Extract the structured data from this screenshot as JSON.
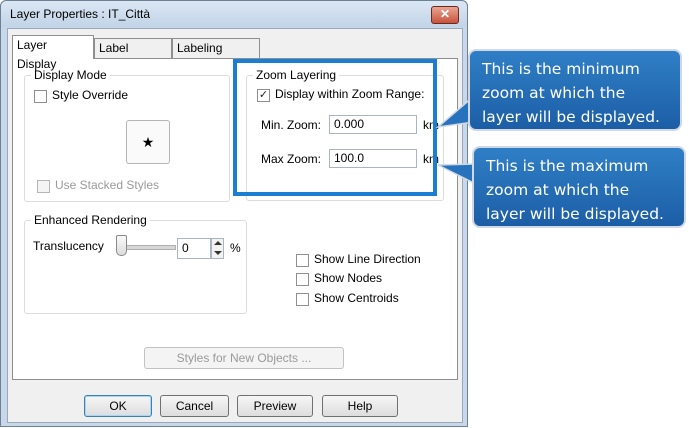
{
  "window": {
    "title": "Layer Properties  : IT_Città",
    "close_glyph": "✕"
  },
  "tabs": [
    {
      "label": "Layer Display",
      "active": true
    },
    {
      "label": "Label Display",
      "active": false
    },
    {
      "label": "Labeling Rules",
      "active": false
    }
  ],
  "display_mode": {
    "title": "Display Mode",
    "style_override": {
      "label": "Style Override",
      "checked": false
    },
    "style_preview_glyph": "★",
    "use_stacked_styles": {
      "label": "Use Stacked Styles",
      "checked": false,
      "enabled": false
    }
  },
  "zoom_layering": {
    "title": "Zoom Layering",
    "display_within_range": {
      "label": "Display within Zoom Range:",
      "checked": true,
      "check_glyph": "✓"
    },
    "min_zoom": {
      "label": "Min. Zoom:",
      "value": "0.000",
      "unit": "km"
    },
    "max_zoom": {
      "label": "Max Zoom:",
      "value": "100.0",
      "unit": "km"
    }
  },
  "enhanced_rendering": {
    "title": "Enhanced Rendering",
    "translucency_label": "Translucency",
    "translucency_value": "0",
    "percent": "%",
    "slider_level_percent": 0
  },
  "options": [
    {
      "label": "Show Line Direction",
      "checked": false
    },
    {
      "label": "Show Nodes",
      "checked": false
    },
    {
      "label": "Show Centroids",
      "checked": false
    }
  ],
  "styles_button": "Styles for New Objects ...",
  "buttons": {
    "ok": "OK",
    "cancel": "Cancel",
    "preview": "Preview",
    "help": "Help"
  },
  "callouts": {
    "min": [
      "This is the minimum",
      "zoom at which the",
      "layer will be displayed."
    ],
    "max": [
      "This is the maximum",
      "zoom at which the",
      "layer will be displayed."
    ]
  },
  "colors": {
    "highlight": "#1b7ed3",
    "callout": "#2672bd"
  }
}
